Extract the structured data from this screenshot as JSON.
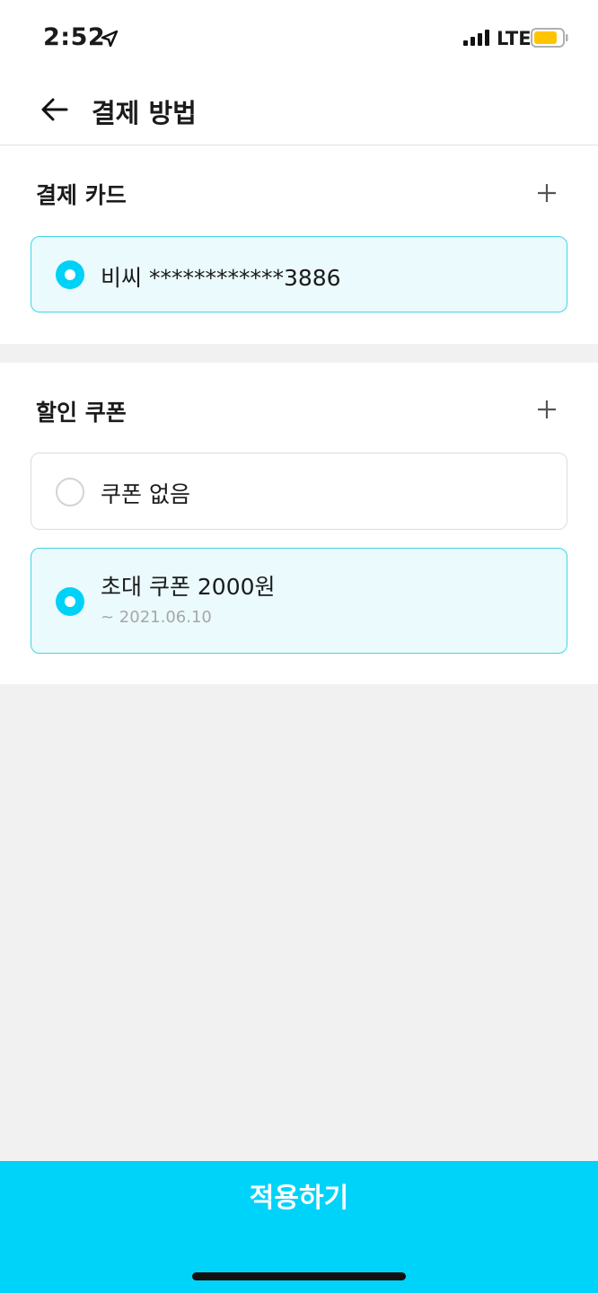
{
  "status_bar": {
    "time": "2:52",
    "network": "LTE",
    "icons": [
      "location-arrow-icon",
      "signal-icon",
      "battery-icon"
    ],
    "battery_color": "#ffc400"
  },
  "header": {
    "back_icon": "arrow-left-icon",
    "title": "결제 방법"
  },
  "payment_card": {
    "title": "결제 카드",
    "add_icon": "plus-icon",
    "options": [
      {
        "label": "비씨 ************3886",
        "selected": true
      }
    ]
  },
  "coupon": {
    "title": "할인 쿠폰",
    "add_icon": "plus-icon",
    "options": [
      {
        "label": "쿠폰 없음",
        "selected": false
      },
      {
        "label": "초대 쿠폰 2000원",
        "sub": "~ 2021.06.10",
        "selected": true
      }
    ]
  },
  "footer": {
    "apply_label": "적용하기"
  },
  "colors": {
    "accent": "#00d3f9",
    "selected_bg": "#ebfafd",
    "selected_border": "#3dd6e6",
    "page_bg": "#f1f1f1"
  }
}
